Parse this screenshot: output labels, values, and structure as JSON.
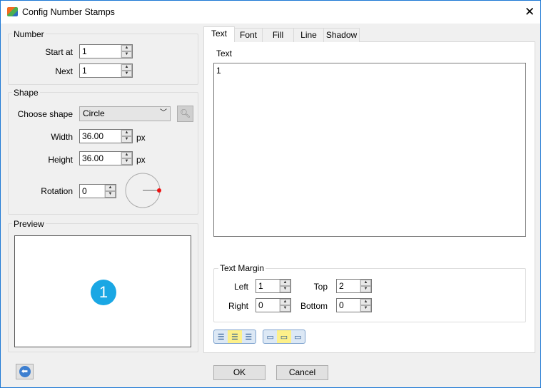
{
  "window": {
    "title": "Config Number Stamps"
  },
  "number": {
    "legend": "Number",
    "start_label": "Start at",
    "start_value": "1",
    "next_label": "Next",
    "next_value": "1"
  },
  "shape": {
    "legend": "Shape",
    "choose_label": "Choose shape",
    "choose_value": "Circle",
    "width_label": "Width",
    "width_value": "36.00",
    "height_label": "Height",
    "height_value": "36.00",
    "unit": "px",
    "rotation_label": "Rotation",
    "rotation_value": "0"
  },
  "preview": {
    "legend": "Preview",
    "stamp_text": "1",
    "stamp_color": "#1aa7e4"
  },
  "tabs": [
    {
      "label": "Text"
    },
    {
      "label": "Font"
    },
    {
      "label": "Fill"
    },
    {
      "label": "Line"
    },
    {
      "label": "Shadow"
    }
  ],
  "text_tab": {
    "text_label": "Text",
    "text_value": "1",
    "margin_legend": "Text Margin",
    "left_label": "Left",
    "left_value": "1",
    "top_label": "Top",
    "top_value": "2",
    "right_label": "Right",
    "right_value": "0",
    "bottom_label": "Bottom",
    "bottom_value": "0"
  },
  "footer": {
    "ok": "OK",
    "cancel": "Cancel"
  }
}
